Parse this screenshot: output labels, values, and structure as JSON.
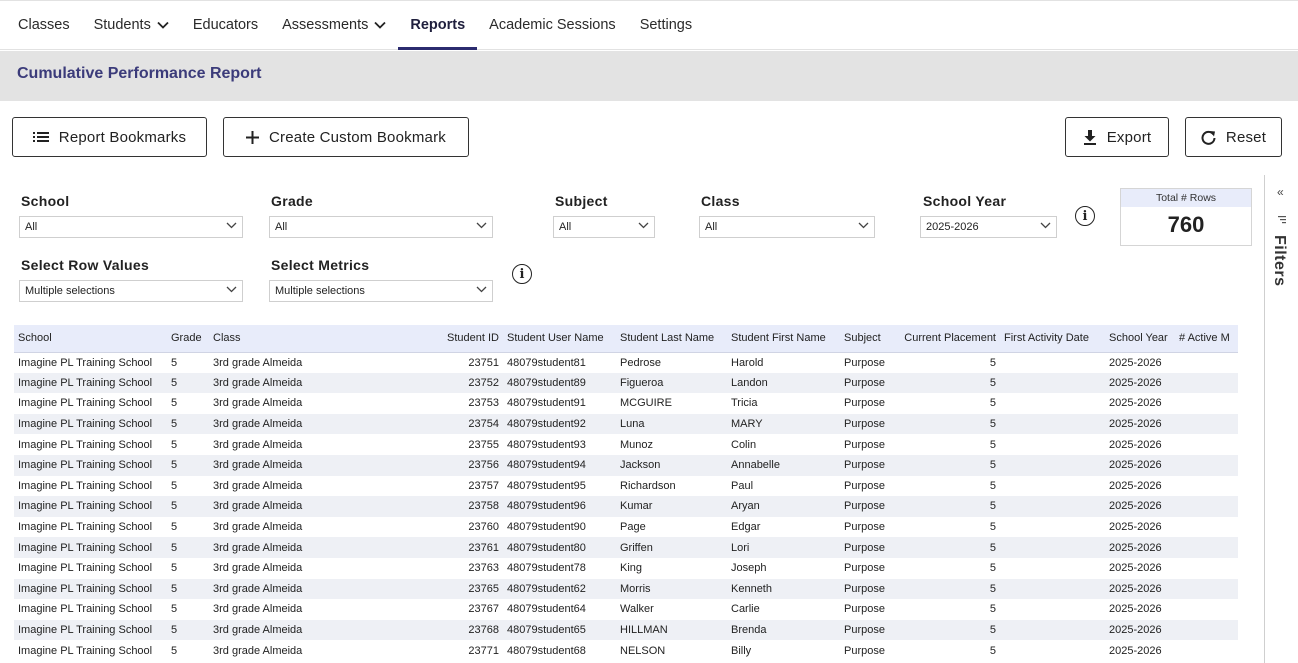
{
  "nav": {
    "items": [
      {
        "label": "Classes",
        "dropdown": false,
        "active": false
      },
      {
        "label": "Students",
        "dropdown": true,
        "active": false
      },
      {
        "label": "Educators",
        "dropdown": false,
        "active": false
      },
      {
        "label": "Assessments",
        "dropdown": true,
        "active": false
      },
      {
        "label": "Reports",
        "dropdown": false,
        "active": true
      },
      {
        "label": "Academic Sessions",
        "dropdown": false,
        "active": false
      },
      {
        "label": "Settings",
        "dropdown": false,
        "active": false
      }
    ]
  },
  "page": {
    "title": "Cumulative Performance Report"
  },
  "toolbar": {
    "bookmarks_label": "Report Bookmarks",
    "create_bookmark_label": "Create Custom Bookmark",
    "export_label": "Export",
    "reset_label": "Reset"
  },
  "filters": {
    "school": {
      "label": "School",
      "value": "All"
    },
    "grade": {
      "label": "Grade",
      "value": "All"
    },
    "subject": {
      "label": "Subject",
      "value": "All"
    },
    "class": {
      "label": "Class",
      "value": "All"
    },
    "school_year": {
      "label": "School Year",
      "value": "2025-2026"
    },
    "row_values": {
      "label": "Select Row Values",
      "value": "Multiple selections"
    },
    "metrics": {
      "label": "Select Metrics",
      "value": "Multiple selections"
    },
    "info_glyph": "i"
  },
  "summary": {
    "title": "Total # Rows",
    "value": "760"
  },
  "side_panel": {
    "label": "Filters",
    "collapse_glyph": "«"
  },
  "table": {
    "columns": [
      "School",
      "Grade",
      "Class",
      "Student ID",
      "Student User Name",
      "Student Last Name",
      "Student First Name",
      "Subject",
      "Current Placement",
      "First Activity Date",
      "School Year",
      "# Active M"
    ],
    "rows": [
      [
        "Imagine PL Training School",
        "5",
        "3rd grade Almeida",
        "23751",
        "48079student81",
        "Pedrose",
        "Harold",
        "Purpose",
        "5",
        "",
        "2025-2026",
        ""
      ],
      [
        "Imagine PL Training School",
        "5",
        "3rd grade Almeida",
        "23752",
        "48079student89",
        "Figueroa",
        "Landon",
        "Purpose",
        "5",
        "",
        "2025-2026",
        ""
      ],
      [
        "Imagine PL Training School",
        "5",
        "3rd grade Almeida",
        "23753",
        "48079student91",
        "MCGUIRE",
        "Tricia",
        "Purpose",
        "5",
        "",
        "2025-2026",
        ""
      ],
      [
        "Imagine PL Training School",
        "5",
        "3rd grade Almeida",
        "23754",
        "48079student92",
        "Luna",
        "MARY",
        "Purpose",
        "5",
        "",
        "2025-2026",
        ""
      ],
      [
        "Imagine PL Training School",
        "5",
        "3rd grade Almeida",
        "23755",
        "48079student93",
        "Munoz",
        "Colin",
        "Purpose",
        "5",
        "",
        "2025-2026",
        ""
      ],
      [
        "Imagine PL Training School",
        "5",
        "3rd grade Almeida",
        "23756",
        "48079student94",
        "Jackson",
        "Annabelle",
        "Purpose",
        "5",
        "",
        "2025-2026",
        ""
      ],
      [
        "Imagine PL Training School",
        "5",
        "3rd grade Almeida",
        "23757",
        "48079student95",
        "Richardson",
        "Paul",
        "Purpose",
        "5",
        "",
        "2025-2026",
        ""
      ],
      [
        "Imagine PL Training School",
        "5",
        "3rd grade Almeida",
        "23758",
        "48079student96",
        "Kumar",
        "Aryan",
        "Purpose",
        "5",
        "",
        "2025-2026",
        ""
      ],
      [
        "Imagine PL Training School",
        "5",
        "3rd grade Almeida",
        "23760",
        "48079student90",
        "Page",
        "Edgar",
        "Purpose",
        "5",
        "",
        "2025-2026",
        ""
      ],
      [
        "Imagine PL Training School",
        "5",
        "3rd grade Almeida",
        "23761",
        "48079student80",
        "Griffen",
        "Lori",
        "Purpose",
        "5",
        "",
        "2025-2026",
        ""
      ],
      [
        "Imagine PL Training School",
        "5",
        "3rd grade Almeida",
        "23763",
        "48079student78",
        "King",
        "Joseph",
        "Purpose",
        "5",
        "",
        "2025-2026",
        ""
      ],
      [
        "Imagine PL Training School",
        "5",
        "3rd grade Almeida",
        "23765",
        "48079student62",
        "Morris",
        "Kenneth",
        "Purpose",
        "5",
        "",
        "2025-2026",
        ""
      ],
      [
        "Imagine PL Training School",
        "5",
        "3rd grade Almeida",
        "23767",
        "48079student64",
        "Walker",
        "Carlie",
        "Purpose",
        "5",
        "",
        "2025-2026",
        ""
      ],
      [
        "Imagine PL Training School",
        "5",
        "3rd grade Almeida",
        "23768",
        "48079student65",
        "HILLMAN",
        "Brenda",
        "Purpose",
        "5",
        "",
        "2025-2026",
        ""
      ],
      [
        "Imagine PL Training School",
        "5",
        "3rd grade Almeida",
        "23771",
        "48079student68",
        "NELSON",
        "Billy",
        "Purpose",
        "5",
        "",
        "2025-2026",
        ""
      ]
    ]
  }
}
